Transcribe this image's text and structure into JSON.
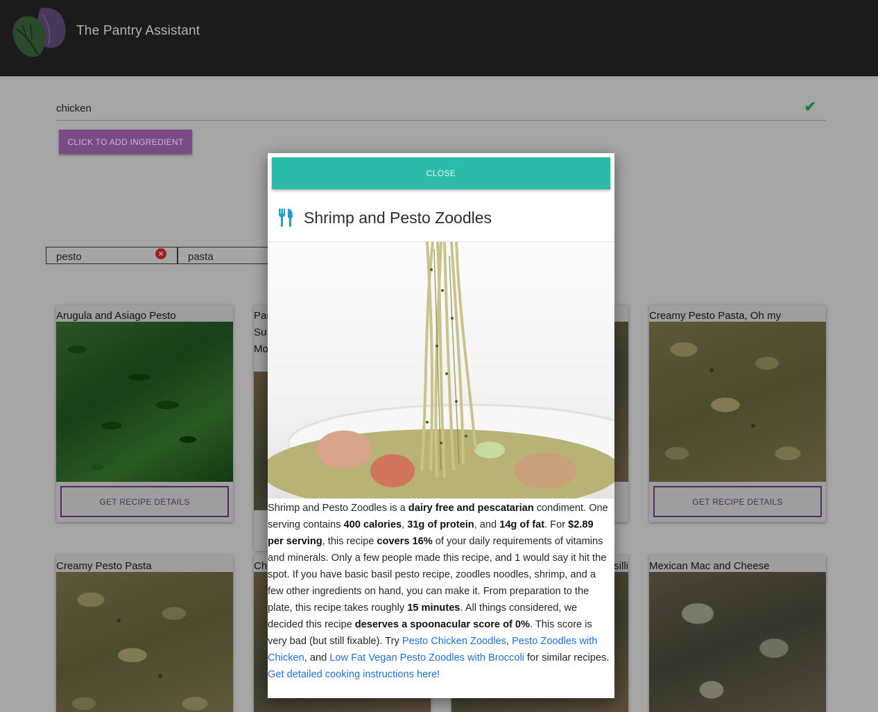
{
  "app": {
    "title": "The Pantry Assistant"
  },
  "ingredient_input": {
    "value": "chicken",
    "add_button_label": "CLICK TO ADD INGREDIENT"
  },
  "chips": [
    {
      "label": "pesto",
      "removable": true
    },
    {
      "label": "pasta",
      "removable": false
    }
  ],
  "cards": [
    {
      "title": "Arugula and Asiago Pesto",
      "button_label": "GET RECIPE DETAILS"
    },
    {
      "title": "Pas",
      "title_line2": "Su",
      "title_line3": "Mo"
    },
    {
      "title": "Creamy Pesto Pasta, Oh my",
      "button_label": "GET RECIPE DETAILS"
    },
    {
      "title": "Creamy Pesto Pasta"
    },
    {
      "title": "Ch"
    },
    {
      "title": "silli"
    },
    {
      "title": "Mexican Mac and Cheese"
    }
  ],
  "modal": {
    "close_label": "CLOSE",
    "icon": "utensils-icon",
    "title": "Shrimp and Pesto Zoodles",
    "description": {
      "s1": "Shrimp and Pesto Zoodles is a ",
      "b1": "dairy free and pescatarian",
      "s2": " condiment. One serving contains ",
      "b2": "400 calories",
      "s3": ", ",
      "b3": "31g of protein",
      "s4": ", and ",
      "b4": "14g of fat",
      "s5": ". For ",
      "b5": "$2.89 per serving",
      "s6": ", this recipe ",
      "b6": "covers 16%",
      "s7": " of your daily requirements of vitamins and minerals. Only a few people made this recipe, and 1 would say it hit the spot. If you have basic basil pesto recipe, zoodles noodles, shrimp, and a few other ingredients on hand, you can make it. From preparation to the plate, this recipe takes roughly ",
      "b7": "15 minutes",
      "s8": ". All things considered, we decided this recipe ",
      "b8": "deserves a spoonacular score of 0%",
      "s9": ". This score is very bad (but still fixable). Try ",
      "l1": "Pesto Chicken Zoodles",
      "s10": ", ",
      "l2": "Pesto Zoodles with Chicken",
      "s11": ", and ",
      "l3": "Low Fat Vegan Pesto Zoodles with Broccoli",
      "s12": " for similar recipes."
    },
    "instructions_link": "Get detailed cooking instructions here!"
  },
  "colors": {
    "header": "#1b1b1b",
    "accent_purple": "#7a4b86",
    "close_teal": "#2bbba9",
    "link_blue": "#1f6fd1",
    "check_green": "#1e7d36"
  }
}
